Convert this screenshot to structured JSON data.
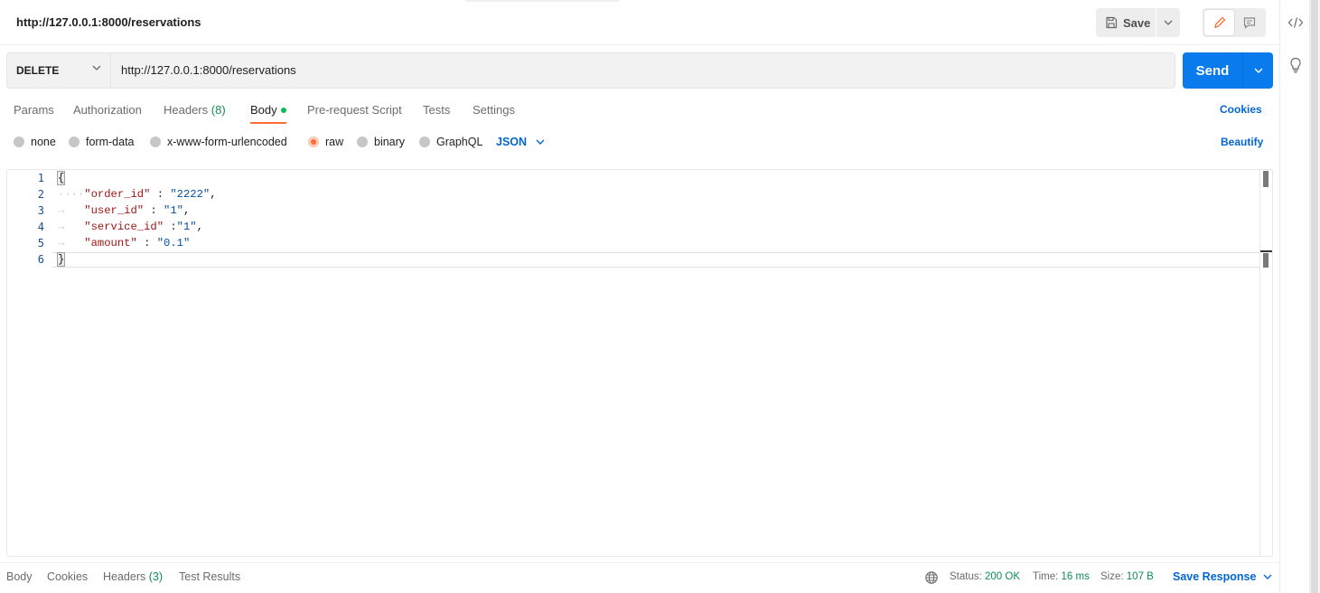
{
  "header": {
    "title": "http://127.0.0.1:8000/reservations",
    "save_label": "Save"
  },
  "request": {
    "method": "DELETE",
    "url": "http://127.0.0.1:8000/reservations",
    "send_label": "Send"
  },
  "tabs": {
    "params": "Params",
    "authorization": "Authorization",
    "headers": "Headers",
    "headers_count": "(8)",
    "body": "Body",
    "prerequest": "Pre-request Script",
    "tests": "Tests",
    "settings": "Settings",
    "cookies": "Cookies"
  },
  "body_options": {
    "none": "none",
    "form_data": "form-data",
    "urlencoded": "x-www-form-urlencoded",
    "raw": "raw",
    "binary": "binary",
    "graphql": "GraphQL",
    "selected": "raw",
    "language": "JSON",
    "beautify": "Beautify"
  },
  "editor": {
    "line_numbers": [
      "1",
      "2",
      "3",
      "4",
      "5",
      "6"
    ],
    "lines": [
      {
        "open": "{"
      },
      {
        "key": "\"order_id\"",
        "sep": " : ",
        "value": "\"2222\"",
        "end": ","
      },
      {
        "key": "\"user_id\"",
        "sep": " : ",
        "value": "\"1\"",
        "end": ","
      },
      {
        "key": "\"service_id\"",
        "sep": " :",
        "value": "\"1\"",
        "end": ","
      },
      {
        "key": "\"amount\"",
        "sep": " : ",
        "value": "\"0.1\"",
        "end": ""
      },
      {
        "close": "}"
      }
    ]
  },
  "footer": {
    "body": "Body",
    "cookies": "Cookies",
    "headers": "Headers",
    "headers_count": "(3)",
    "test_results": "Test Results",
    "status_label": "Status:",
    "status_value": "200 OK",
    "time_label": "Time:",
    "time_value": "16 ms",
    "size_label": "Size:",
    "size_value": "107 B",
    "save_response": "Save Response"
  },
  "icons": {
    "save": "save-icon",
    "edit": "pencil-icon",
    "comment": "comment-icon",
    "code": "code-icon",
    "bulb": "lightbulb-icon",
    "globe": "globe-icon"
  },
  "colors": {
    "accent_orange": "#ff6c37",
    "send_blue": "#097bed",
    "link_blue": "#0265d2",
    "success_green": "#0f8e54"
  }
}
